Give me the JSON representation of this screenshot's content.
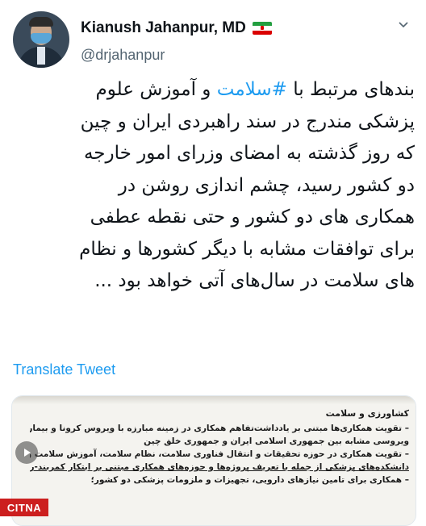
{
  "author": {
    "display_name": "Kianush Jahanpur, MD",
    "handle": "@drjahanpur"
  },
  "tweet": {
    "lines": [
      [
        "بندهای مرتبط با ",
        "#سلامت",
        " و آموزش علوم"
      ],
      [
        "پزشکی مندرج در سند راهبردی ایران و چین"
      ],
      [
        "که روز گذشته به امضای وزرای امور خارجه"
      ],
      [
        "دو کشور رسید، چشم اندازی روشن در"
      ],
      [
        "همکاری های دو کشور و حتی نقطه عطفی"
      ],
      [
        "برای توافقات مشابه با دیگر کشورها و نظام"
      ],
      [
        "های سلامت در سال‌های آتی خواهد بود ..."
      ]
    ]
  },
  "translate_label": "Translate Tweet",
  "document": {
    "heading": "کشاورزی و سلامت",
    "lines": [
      "– تقویت همکاری‌ها مبتنی بر یادداشت‌تفاهم همکاری در زمینه مبارزه با ویروس کرونا و بیماری‌های",
      "ویروسی مشابه بین جمهوری اسلامی ایران و جمهوری خلق چین",
      "– تقویت همکاری در حوزه تحقیقات و انتقال فناوری سلامت، نظام سلامت، آموزش سلامت و همکاری",
      "دانشکده‌های پزشکی از جمله با تعریف پروژه‌ها و حوزه‌های همکاری مبتنی بر ابتکار کمربند-راه.",
      "– همکاری برای تامین نیازهای دارویی، تجهیزات و ملزومات پزشکی دو کشور؛"
    ]
  },
  "watermark": "CITNA",
  "colors": {
    "link": "#1d9bf0",
    "text": "#0f1419",
    "secondary": "#536471"
  }
}
